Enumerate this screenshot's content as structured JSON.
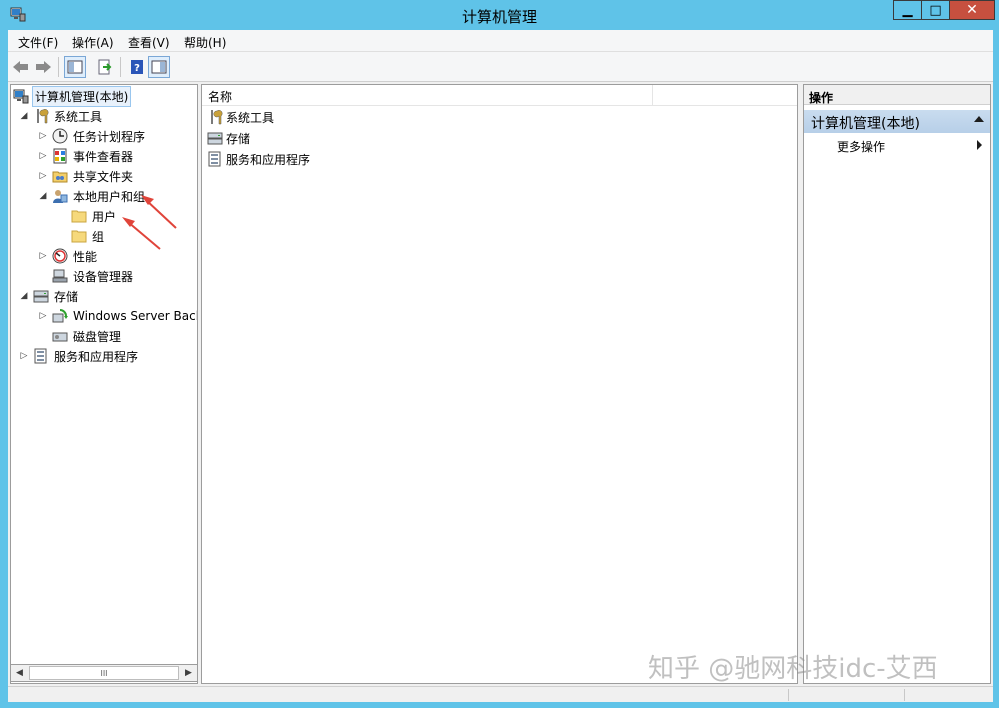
{
  "window": {
    "title": "计算机管理",
    "controls": {
      "minimize": "▁",
      "maximize": "□",
      "close": "✕"
    }
  },
  "menu": {
    "file": "文件(F)",
    "action": "操作(A)",
    "view": "查看(V)",
    "help": "帮助(H)"
  },
  "tree": {
    "root": "计算机管理(本地)",
    "system_tools": "系统工具",
    "task_scheduler": "任务计划程序",
    "event_viewer": "事件查看器",
    "shared_folders": "共享文件夹",
    "local_users_groups": "本地用户和组",
    "users": "用户",
    "groups": "组",
    "performance": "性能",
    "device_manager": "设备管理器",
    "storage": "存储",
    "windows_server_backup": "Windows Server Back",
    "disk_management": "磁盘管理",
    "services_apps": "服务和应用程序",
    "scroll_thumb": "III"
  },
  "list": {
    "column_name": "名称",
    "rows": [
      "系统工具",
      "存储",
      "服务和应用程序"
    ]
  },
  "actions": {
    "header": "操作",
    "section": "计算机管理(本地)",
    "more": "更多操作"
  },
  "watermark": "知乎 @驰网科技idc-艾西",
  "colors": {
    "titlebar": "#5fc3e8",
    "close_button": "#c7503f",
    "annotation_arrow": "#e0443a"
  },
  "icons": [
    "app-icon",
    "back-icon",
    "forward-icon",
    "console-tree-icon",
    "export-icon",
    "help-icon",
    "properties-icon",
    "computer-icon",
    "tools-icon",
    "clock-icon",
    "event-icon",
    "share-icon",
    "users-icon",
    "folder-icon",
    "perf-icon",
    "device-icon",
    "storage-icon",
    "backup-icon",
    "disk-icon",
    "services-icon"
  ]
}
